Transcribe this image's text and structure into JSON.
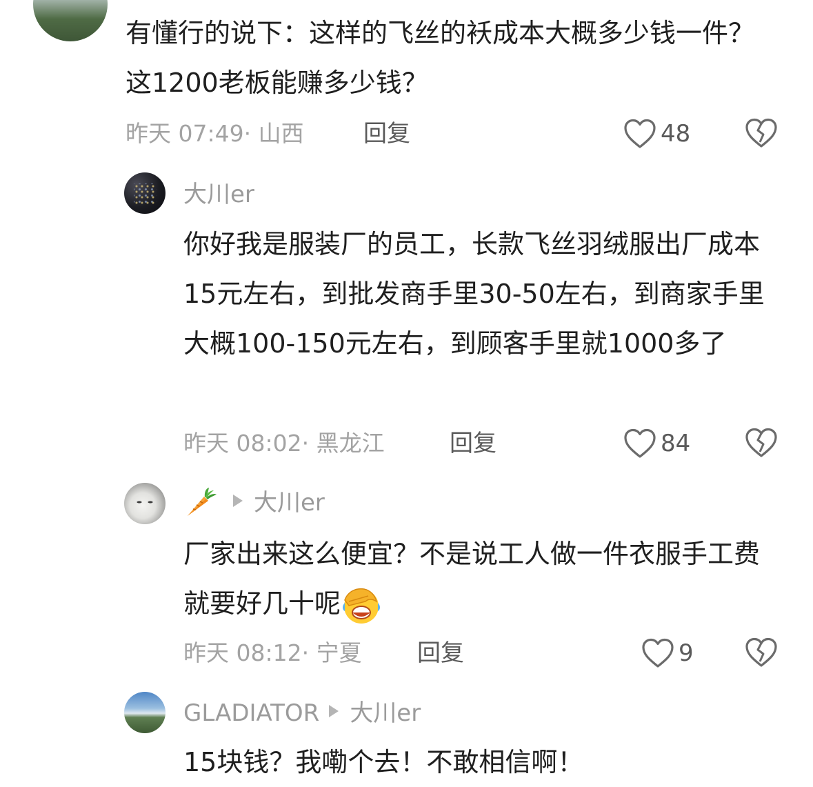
{
  "comments": [
    {
      "text": "有懂行的说下：这样的飞丝的袄成本大概多少钱一件？这1200老板能赚多少钱？",
      "meta": "昨天 07:49· 山西",
      "reply_label": "回复",
      "likes": "48"
    },
    {
      "author": "大川er",
      "text": "你好我是服装厂的员工，长款飞丝羽绒服出厂成本15元左右，到批发商手里30-50左右，到商家手里大概100-150元左右，到顾客手里就1000多了",
      "meta": "昨天 08:02· 黑龙江",
      "reply_label": "回复",
      "likes": "84"
    },
    {
      "author_icon": "carrot-emoji-icon",
      "reply_to": "大川er",
      "text": "厂家出来这么便宜？不是说工人做一件衣服手工费就要好几十呢",
      "text_emoji": "facepalm-laughing-emoji-icon",
      "meta": "昨天 08:12· 宁夏",
      "reply_label": "回复",
      "likes": "9"
    },
    {
      "author": "GLADIATOR",
      "reply_to": "大川er",
      "text": "15块钱？我嘞个去！不敢相信啊！"
    }
  ],
  "icons": {
    "like": "heart-outline-icon",
    "dislike": "broken-heart-icon"
  }
}
